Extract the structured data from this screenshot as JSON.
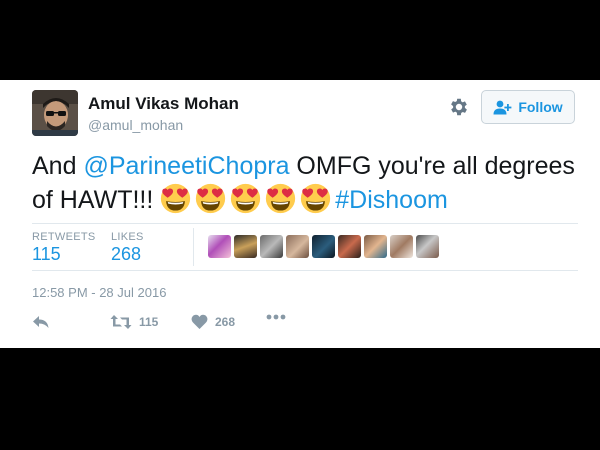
{
  "tweet": {
    "author_name": "Amul Vikas Mohan",
    "author_handle": "@amul_mohan",
    "follow_label": "Follow",
    "text_prefix": "And ",
    "mention": "@ParineetiChopra",
    "text_middle": " OMFG you're all degrees of HAWT!!! ",
    "hashtag": "#Dishoom",
    "emoji_name": "smiling-face-heart-eyes-icon",
    "emoji_count": 5,
    "retweets_label": "RETWEETS",
    "retweets_value": "115",
    "likes_label": "LIKES",
    "likes_value": "268",
    "timestamp": "12:58 PM - 28 Jul 2016",
    "action_retweet_count": "115",
    "action_like_count": "268"
  },
  "colors": {
    "link": "#1b95e0",
    "muted": "#8899a6",
    "divider": "#e1e8ed",
    "background": "#000000"
  }
}
